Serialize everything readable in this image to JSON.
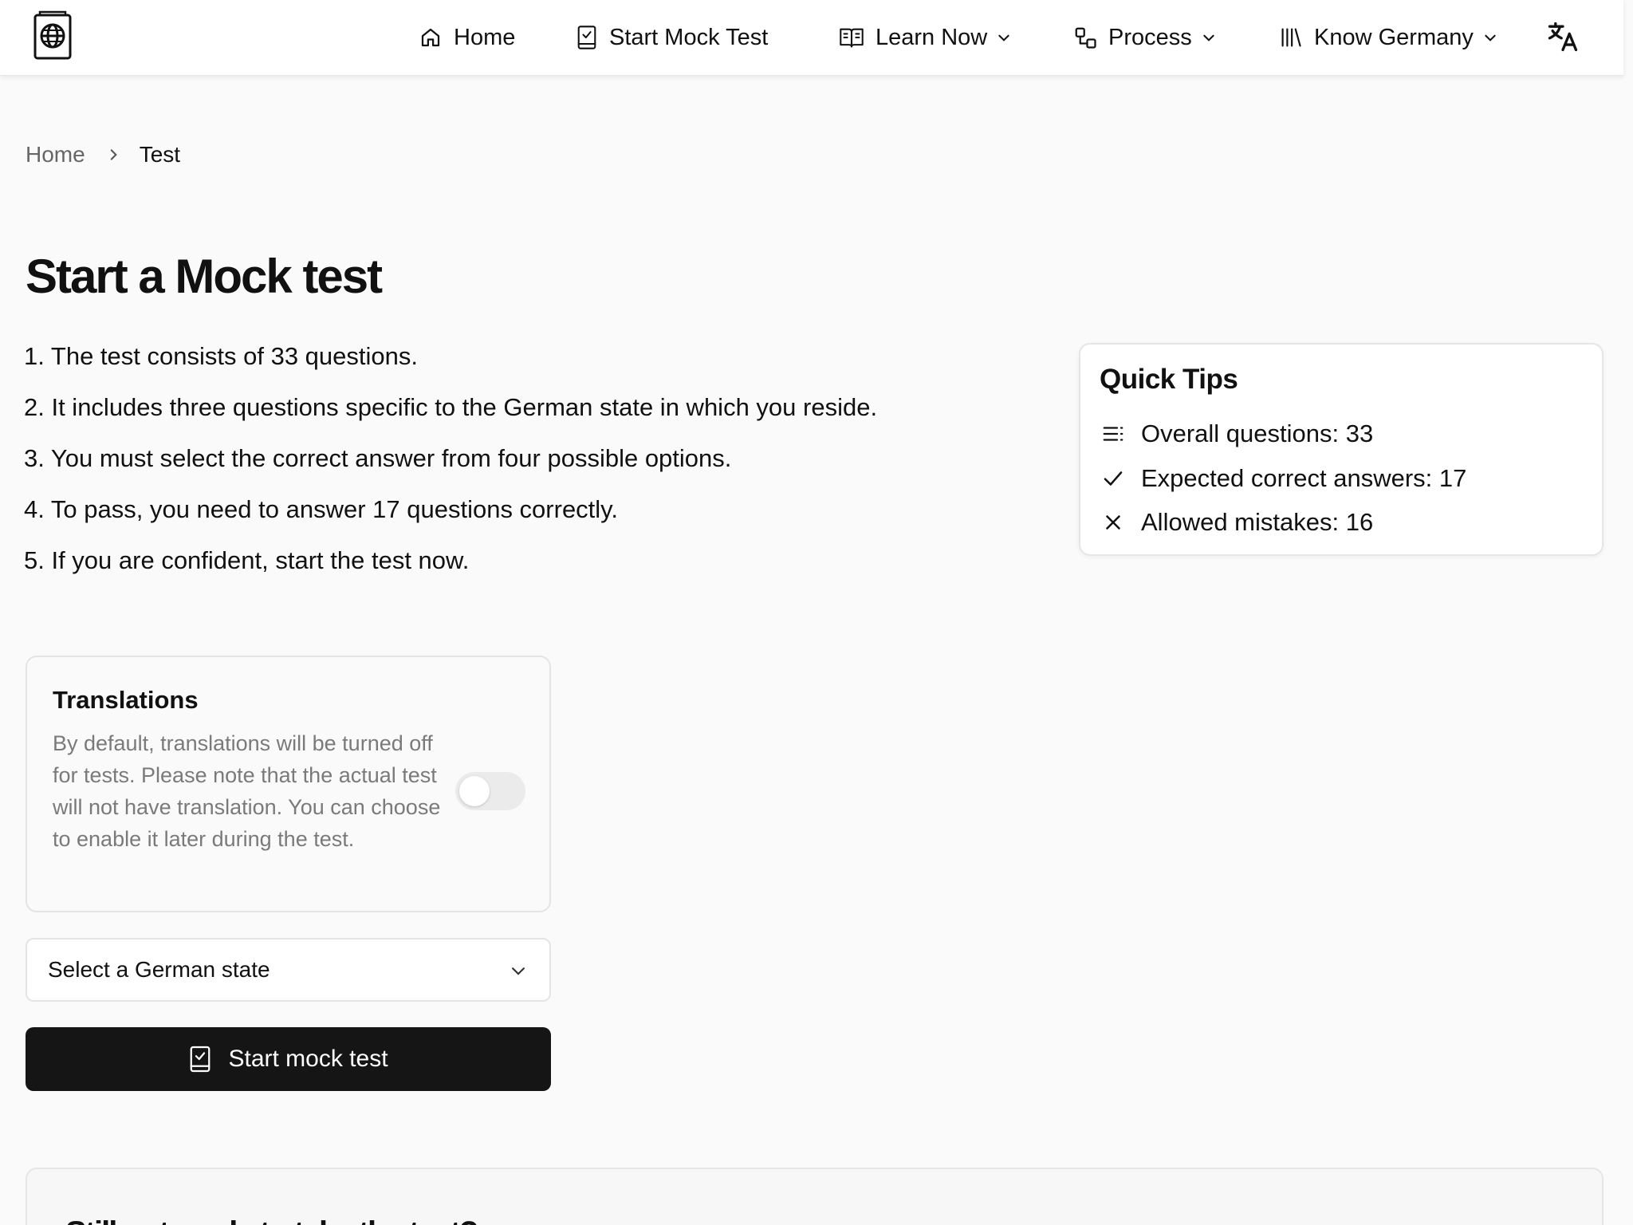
{
  "header": {
    "nav": [
      {
        "label": "Home",
        "icon": "home-icon"
      },
      {
        "label": "Start Mock Test",
        "icon": "checklist-icon"
      },
      {
        "label": "Learn Now",
        "icon": "open-book-icon",
        "dropdown": true
      },
      {
        "label": "Process",
        "icon": "process-icon",
        "dropdown": true
      },
      {
        "label": "Know Germany",
        "icon": "library-icon",
        "dropdown": true
      }
    ],
    "language_icon": "translate-icon"
  },
  "breadcrumb": {
    "home": "Home",
    "current": "Test"
  },
  "main": {
    "title": "Start a Mock test",
    "instructions": [
      "1. The test consists of 33 questions.",
      "2. It includes three questions specific to the German state in which you reside.",
      "3. You must select the correct answer from four possible options.",
      "4. To pass, you need to answer 17 questions correctly.",
      "5. If you are confident, start the test now."
    ]
  },
  "tips": {
    "title": "Quick Tips",
    "items": [
      {
        "icon": "list-icon",
        "text": "Overall questions: 33"
      },
      {
        "icon": "check-icon",
        "text": "Expected correct answers: 17"
      },
      {
        "icon": "close-icon",
        "text": "Allowed mistakes: 16"
      }
    ]
  },
  "translations": {
    "title": "Translations",
    "description": "By default, translations will be turned off for tests. Please note that the actual test will not have translation. You can choose to enable it later during the test.",
    "enabled": false
  },
  "state_select": {
    "placeholder": "Select a German state"
  },
  "start_button": {
    "label": "Start mock test"
  },
  "not_ready": {
    "title": "Still not ready to take the test?"
  },
  "colors": {
    "button_bg": "#151515",
    "page_bg": "#fafafa",
    "muted_text": "#7a7a7a"
  }
}
